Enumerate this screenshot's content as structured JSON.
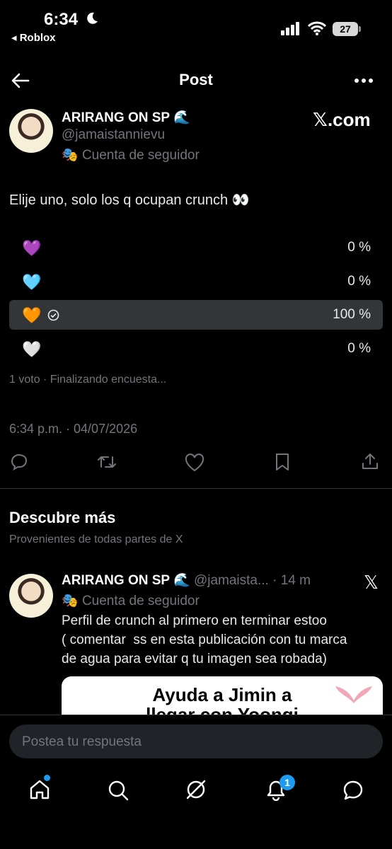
{
  "status_bar": {
    "time": "6:34",
    "back_app": "◂ Roblox",
    "battery": "27"
  },
  "header": {
    "title": "Post"
  },
  "post": {
    "author_name": "ARIRANG ON SP 🌊",
    "handle": "@jamaistannievu",
    "account_label": "Cuenta de seguidor",
    "source": "𝕏.com",
    "text": "Elije uno, solo los q ocupan crunch 👀",
    "poll": {
      "options": [
        {
          "emoji": "💜",
          "percent": "0 %",
          "selected": false
        },
        {
          "emoji": "🩵",
          "percent": "0 %",
          "selected": false
        },
        {
          "emoji": "🧡",
          "percent": "100 %",
          "selected": true
        },
        {
          "emoji": "🤍",
          "percent": "0 %",
          "selected": false
        }
      ],
      "meta": "1 voto · Finalizando encuesta..."
    },
    "timestamp": "6:34 p.m. · 04/07/2026"
  },
  "discover": {
    "title": "Descubre más",
    "subtitle": "Provenientes de todas partes de X",
    "item": {
      "author_name": "ARIRANG ON SP 🌊",
      "handle_time": "@jamaista... · 14 m",
      "account_label": "Cuenta de seguidor",
      "text_line1": "Perfil de crunch al primero en terminar estoo",
      "text_line2": "( comentar  ss en esta publicación con tu marca",
      "text_line3": "de agua para evitar q tu imagen sea robada)",
      "card_line1": "Ayuda a Jimin a",
      "card_line2": "llegar con Yoongi"
    }
  },
  "reply": {
    "placeholder": "Postea tu respuesta"
  },
  "bottom_nav": {
    "notifications_badge": "1"
  }
}
